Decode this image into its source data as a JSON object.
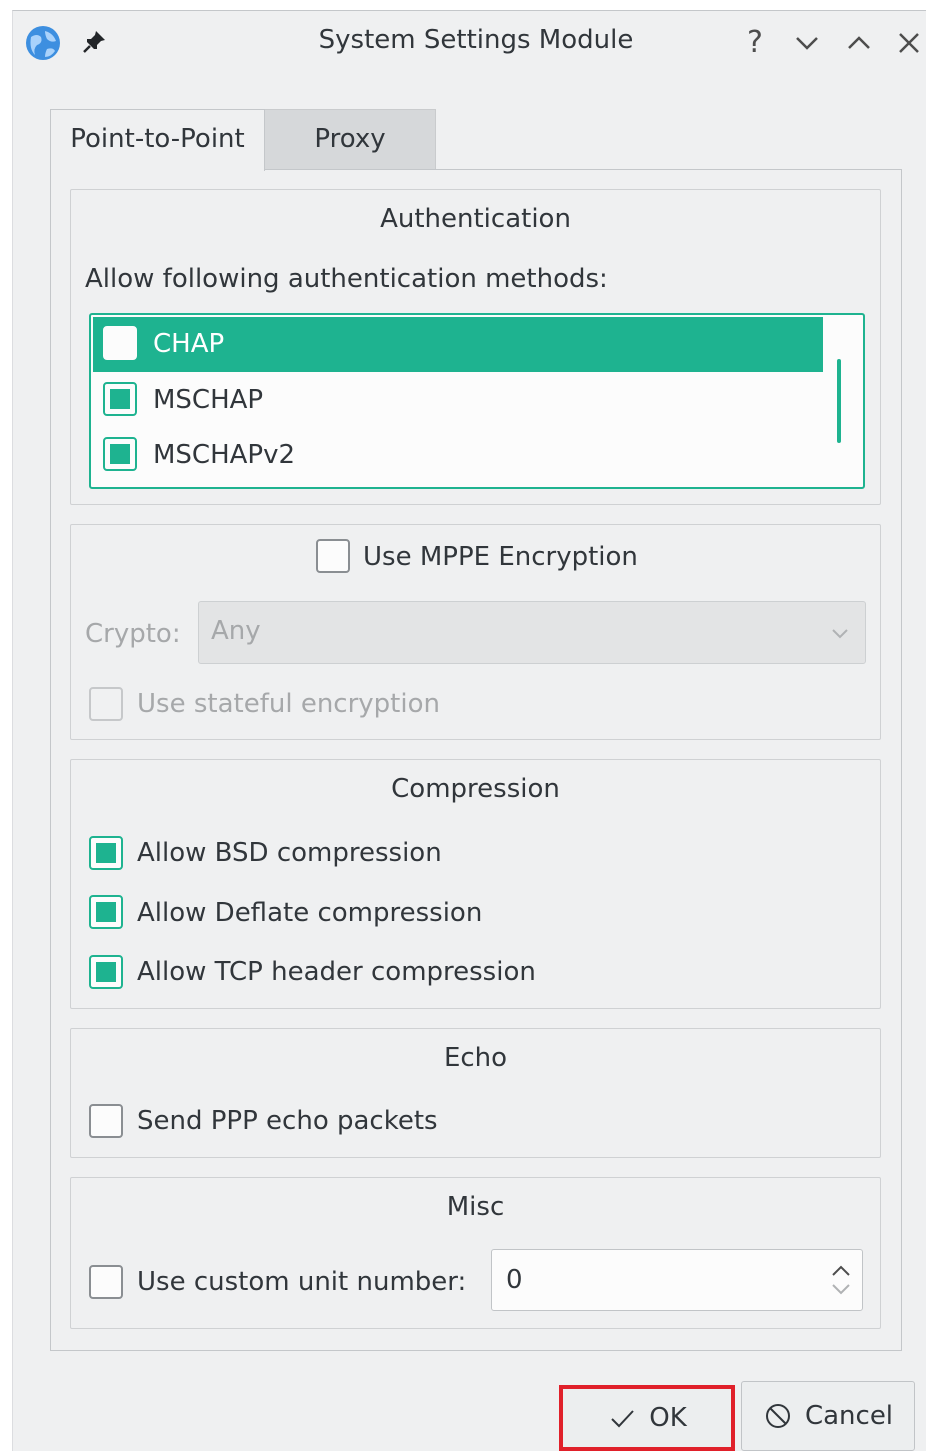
{
  "window": {
    "title": "System Settings Module",
    "help_label": "?"
  },
  "tabs": [
    {
      "label": "Point-to-Point",
      "active": true
    },
    {
      "label": "Proxy",
      "active": false
    }
  ],
  "authentication": {
    "title": "Authentication",
    "prompt": "Allow following authentication methods:",
    "methods": [
      {
        "label": "CHAP",
        "checked": false,
        "selected": true
      },
      {
        "label": "MSCHAP",
        "checked": true,
        "selected": false
      },
      {
        "label": "MSCHAPv2",
        "checked": true,
        "selected": false
      }
    ]
  },
  "encryption": {
    "use_mppe_label": "Use MPPE Encryption",
    "use_mppe_checked": false,
    "crypto_label": "Crypto:",
    "crypto_value": "Any",
    "stateful_label": "Use stateful encryption",
    "stateful_checked": false
  },
  "compression": {
    "title": "Compression",
    "bsd_label": "Allow BSD compression",
    "deflate_label": "Allow Deflate compression",
    "tcp_label": "Allow TCP header compression"
  },
  "echo": {
    "title": "Echo",
    "send_label": "Send PPP echo packets"
  },
  "misc": {
    "title": "Misc",
    "custom_unit_label": "Use custom unit number:",
    "unit_value": "0"
  },
  "buttons": {
    "ok_label": "OK",
    "cancel_label": "Cancel"
  },
  "colors": {
    "accent": "#1eb390",
    "highlight_border": "#e0202a",
    "window_bg": "#eff0f1"
  }
}
